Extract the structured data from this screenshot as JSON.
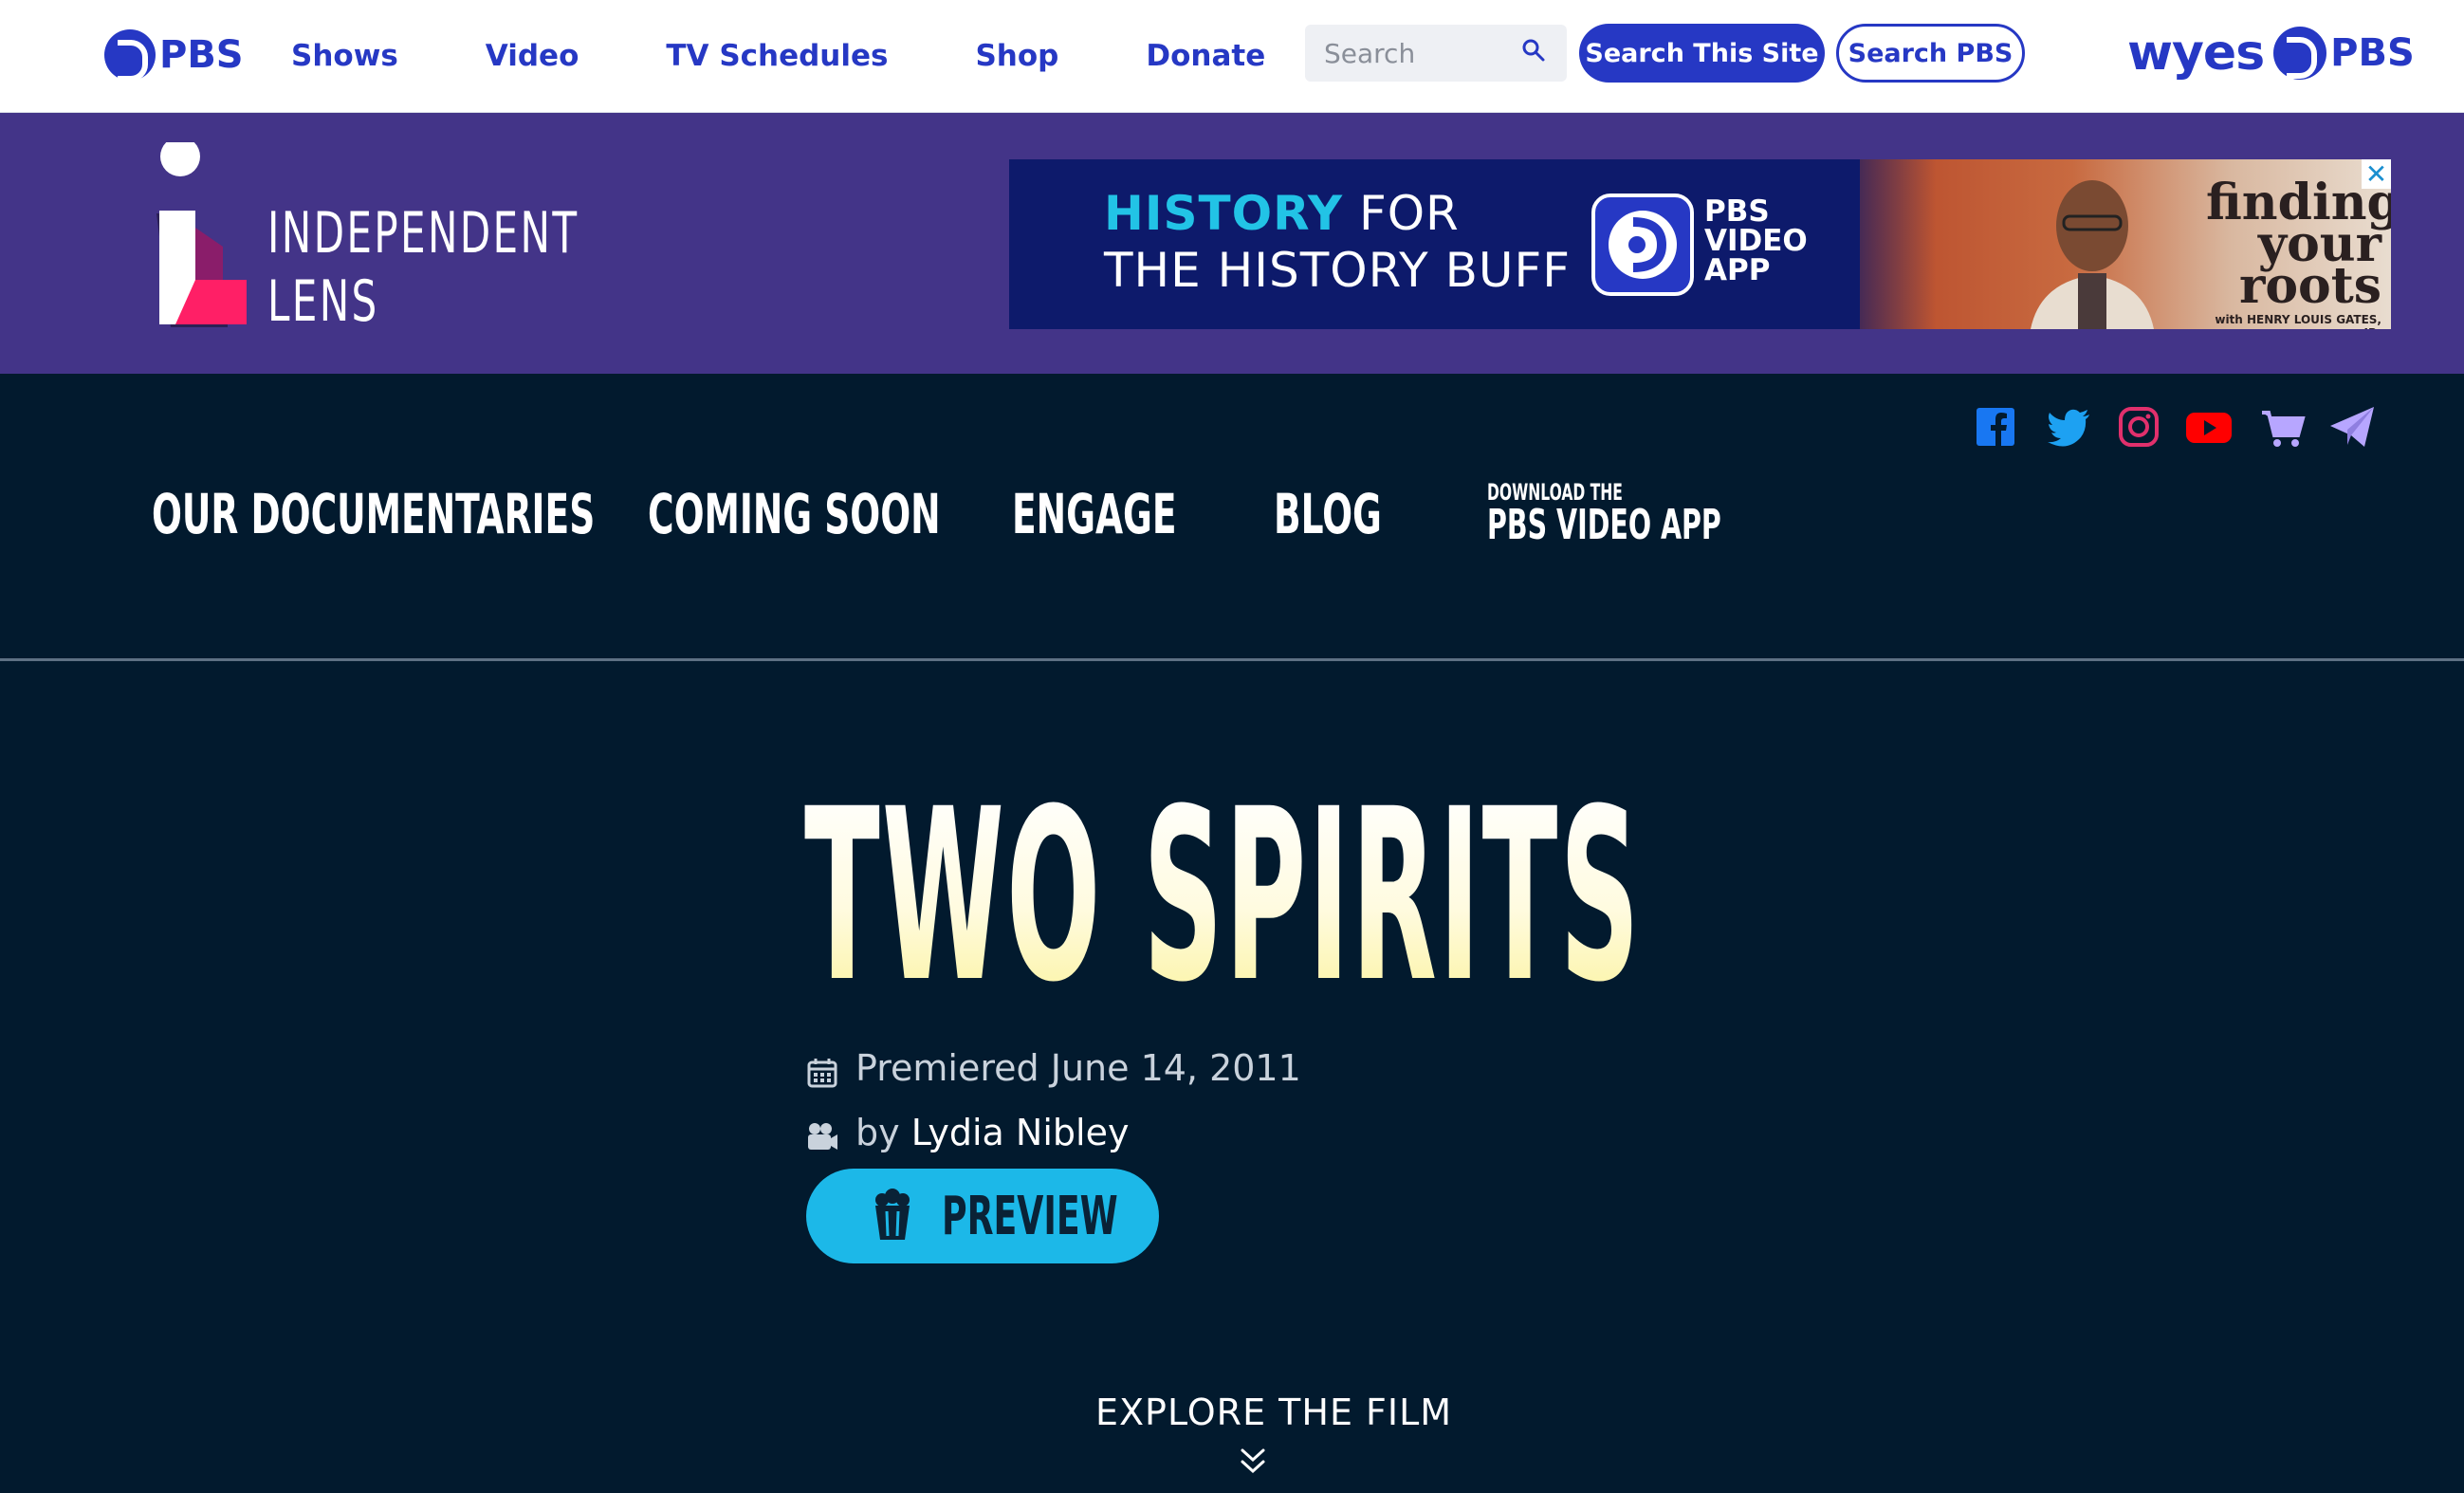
{
  "pbs_header": {
    "logo_text": "PBS",
    "nav": [
      "Shows",
      "Video",
      "TV Schedules",
      "Shop",
      "Donate"
    ],
    "search_placeholder": "Search",
    "search_site_label": "Search This Site",
    "search_pbs_label": "Search PBS",
    "station_logo_text": "wyes",
    "station_logo_pbs": "PBS"
  },
  "il_header": {
    "logo_line1": "INDEPENDENT",
    "logo_line2": "LENS"
  },
  "ad": {
    "headline_accent": "HISTORY",
    "headline_rest": " FOR",
    "headline_line2": "THE HISTORY BUFF",
    "app_line1": "PBS",
    "app_line2": "VIDEO",
    "app_line3": "APP",
    "show_title_line1": "finding",
    "show_title_line2": "your",
    "show_title_line3": "roots",
    "show_subtitle": "with HENRY LOUIS GATES, JR.",
    "close_label": "✕"
  },
  "social_icons": [
    "facebook-icon",
    "twitter-icon",
    "instagram-icon",
    "youtube-icon",
    "shop-cart-icon",
    "newsletter-icon"
  ],
  "main_nav": {
    "items": [
      "OUR DOCUMENTARIES",
      "COMING SOON",
      "ENGAGE",
      "BLOG"
    ],
    "app_small": "DOWNLOAD THE",
    "app_big": "PBS VIDEO APP"
  },
  "film": {
    "title": "TWO SPIRITS",
    "premiered": "Premiered June 14, 2011",
    "by_prefix": "by ",
    "director": "Lydia Nibley",
    "preview_label": "PREVIEW",
    "explore_label": "EXPLORE THE FILM"
  },
  "colors": {
    "pbs_blue": "#2638c4",
    "il_purple": "#433488",
    "page_dark": "#021a2e",
    "preview_cyan": "#1cb8e8"
  }
}
